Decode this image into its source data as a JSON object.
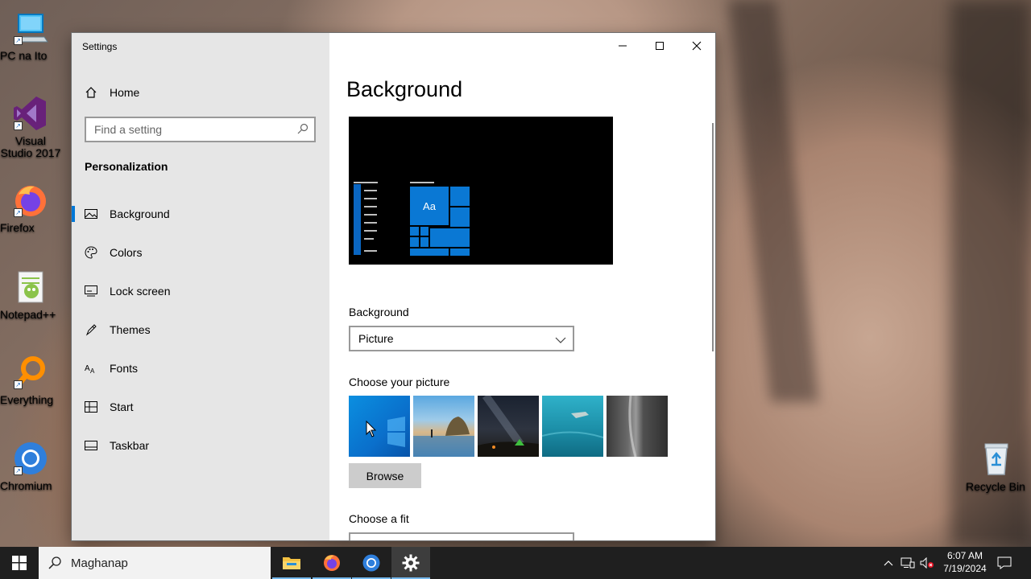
{
  "desktop": {
    "icons": [
      {
        "label": "PC na Ito",
        "icon": "computer-icon"
      },
      {
        "label": "Visual Studio 2017",
        "icon": "visual-studio-icon"
      },
      {
        "label": "Firefox",
        "icon": "firefox-icon"
      },
      {
        "label": "Notepad++",
        "icon": "notepadpp-icon"
      },
      {
        "label": "Everything",
        "icon": "everything-search-icon"
      },
      {
        "label": "Chromium",
        "icon": "chromium-icon"
      },
      {
        "label": "Recycle Bin",
        "icon": "recycle-bin-icon"
      }
    ]
  },
  "window": {
    "title": "Settings",
    "controls": [
      "minimize",
      "maximize",
      "close"
    ]
  },
  "sidebar": {
    "home_label": "Home",
    "search_placeholder": "Find a setting",
    "section_title": "Personalization",
    "items": [
      {
        "label": "Background",
        "icon": "picture-icon",
        "active": true
      },
      {
        "label": "Colors",
        "icon": "palette-icon",
        "active": false
      },
      {
        "label": "Lock screen",
        "icon": "lock-screen-icon",
        "active": false
      },
      {
        "label": "Themes",
        "icon": "themes-icon",
        "active": false
      },
      {
        "label": "Fonts",
        "icon": "fonts-icon",
        "active": false
      },
      {
        "label": "Start",
        "icon": "start-icon",
        "active": false
      },
      {
        "label": "Taskbar",
        "icon": "taskbar-icon",
        "active": false
      }
    ]
  },
  "main": {
    "title": "Background",
    "preview_sample_text": "Aa",
    "background_label": "Background",
    "background_value": "Picture",
    "choose_picture_label": "Choose your picture",
    "pictures": [
      "windows-blue",
      "beach-rock",
      "night-sky",
      "underwater-swimmer",
      "rock-cliff"
    ],
    "browse_label": "Browse",
    "choose_fit_label": "Choose a fit"
  },
  "taskbar": {
    "search_placeholder": "Maghanap",
    "apps": [
      "file-explorer-icon",
      "firefox-icon",
      "chromium-icon",
      "settings-gear-icon"
    ],
    "clock_time": "6:07 AM",
    "clock_date": "7/19/2024"
  },
  "colors": {
    "accent": "#0078d7",
    "sidebar_bg": "#e6e6e6",
    "taskbar_bg": "#1f1f1f"
  }
}
